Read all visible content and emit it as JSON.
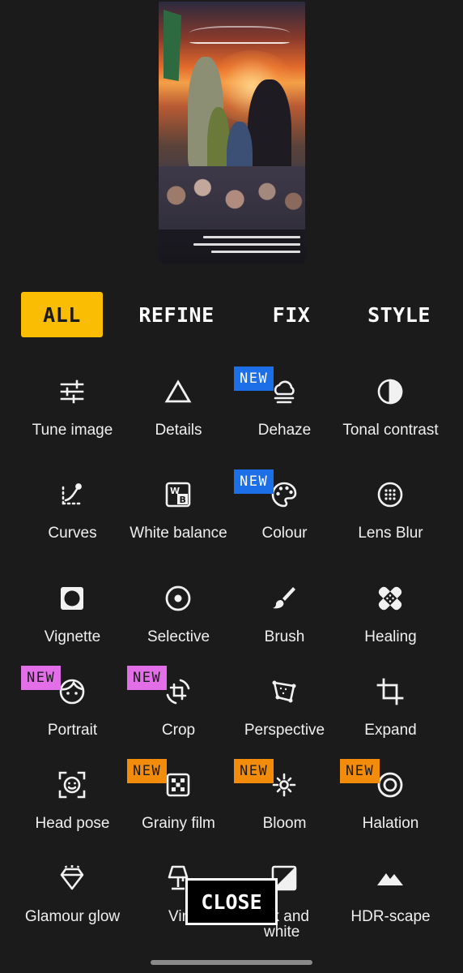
{
  "tabs": {
    "all": "ALL",
    "refine": "REFINE",
    "fix": "FIX",
    "style": "STYLE",
    "active": "ALL"
  },
  "badge_text": "NEW",
  "tools": {
    "tune_image": {
      "label": "Tune image",
      "icon": "sliders-icon"
    },
    "details": {
      "label": "Details",
      "icon": "triangle-icon"
    },
    "dehaze": {
      "label": "Dehaze",
      "icon": "haze-cloud-icon",
      "badge": "NEW"
    },
    "tonal_contrast": {
      "label": "Tonal contrast",
      "icon": "tonal-contrast-icon"
    },
    "curves": {
      "label": "Curves",
      "icon": "curves-icon"
    },
    "white_balance": {
      "label": "White balance",
      "icon": "white-balance-icon"
    },
    "colour": {
      "label": "Colour",
      "icon": "palette-icon",
      "badge": "NEW"
    },
    "lens_blur": {
      "label": "Lens Blur",
      "icon": "lens-blur-icon"
    },
    "vignette": {
      "label": "Vignette",
      "icon": "vignette-icon"
    },
    "selective": {
      "label": "Selective",
      "icon": "target-dot-icon"
    },
    "brush": {
      "label": "Brush",
      "icon": "brush-icon"
    },
    "healing": {
      "label": "Healing",
      "icon": "bandage-icon"
    },
    "portrait": {
      "label": "Portrait",
      "icon": "face-icon",
      "badge": "NEW"
    },
    "crop": {
      "label": "Crop",
      "icon": "crop-rotate-icon",
      "badge": "NEW"
    },
    "perspective": {
      "label": "Perspective",
      "icon": "perspective-icon"
    },
    "expand": {
      "label": "Expand",
      "icon": "crop-icon"
    },
    "head_pose": {
      "label": "Head pose",
      "icon": "face-frame-icon"
    },
    "grainy_film": {
      "label": "Grainy film",
      "icon": "dice-icon",
      "badge": "NEW"
    },
    "bloom": {
      "label": "Bloom",
      "icon": "sparkle-icon",
      "badge": "NEW"
    },
    "halation": {
      "label": "Halation",
      "icon": "concentric-circle-icon",
      "badge": "NEW"
    },
    "glamour_glow": {
      "label": "Glamour glow",
      "icon": "diamond-icon"
    },
    "vintage": {
      "label": "Vinta",
      "icon": "lamp-icon"
    },
    "black_and_white": {
      "label": "ck and white",
      "icon": "bw-filter-icon"
    },
    "hdr_scape": {
      "label": "HDR-scape",
      "icon": "mountains-icon"
    }
  },
  "close_label": "CLOSE",
  "colors": {
    "background": "#1b1b1b",
    "accent": "#fbbc04",
    "badge_blue": "#1d6fe8",
    "badge_pink": "#e26ee8",
    "badge_orange": "#f48c0b"
  }
}
